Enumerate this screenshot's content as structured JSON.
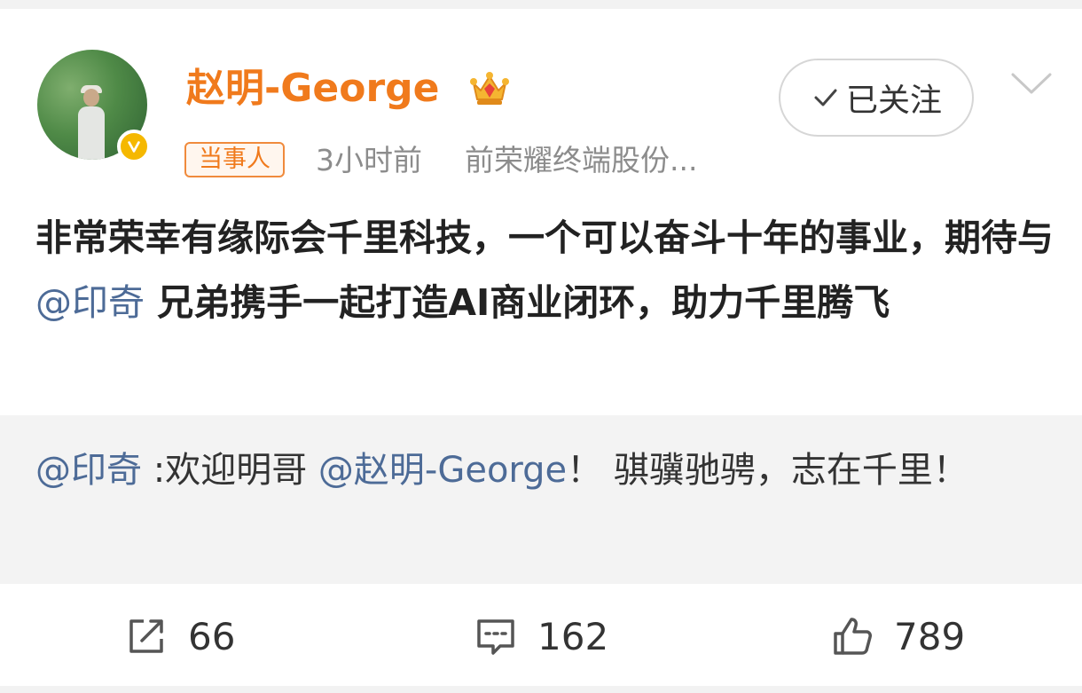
{
  "header": {
    "username": "赵明-George",
    "tag": "当事人",
    "time": "3小时前",
    "source": "前荣耀终端股份..."
  },
  "follow": {
    "label": "已关注"
  },
  "post": {
    "text_part1": "非常荣幸有缘际会千里科技，一个可以奋斗十年的事业，期待与",
    "mention": "@印奇",
    "text_part2": " 兄弟携手一起打造AI商业闭环，助力千里腾飞"
  },
  "repost": {
    "mention1": "@印奇",
    "text1": " :欢迎明哥 ",
    "mention2": "@赵明-George",
    "text2": "！ 骐骥驰骋，志在千里！"
  },
  "actions": {
    "repost_count": "66",
    "comment_count": "162",
    "like_count": "789"
  },
  "colors": {
    "username": "#f07a1c",
    "mention": "#4d6b97",
    "verified_badge": "#f5b800"
  },
  "icons": {
    "avatar": "avatar",
    "verified": "verified-badge-icon",
    "crown": "crown-icon",
    "check": "check-icon",
    "dropdown": "chevron-down-icon",
    "repost": "repost-icon",
    "comment": "comment-icon",
    "like": "thumbs-up-icon"
  }
}
